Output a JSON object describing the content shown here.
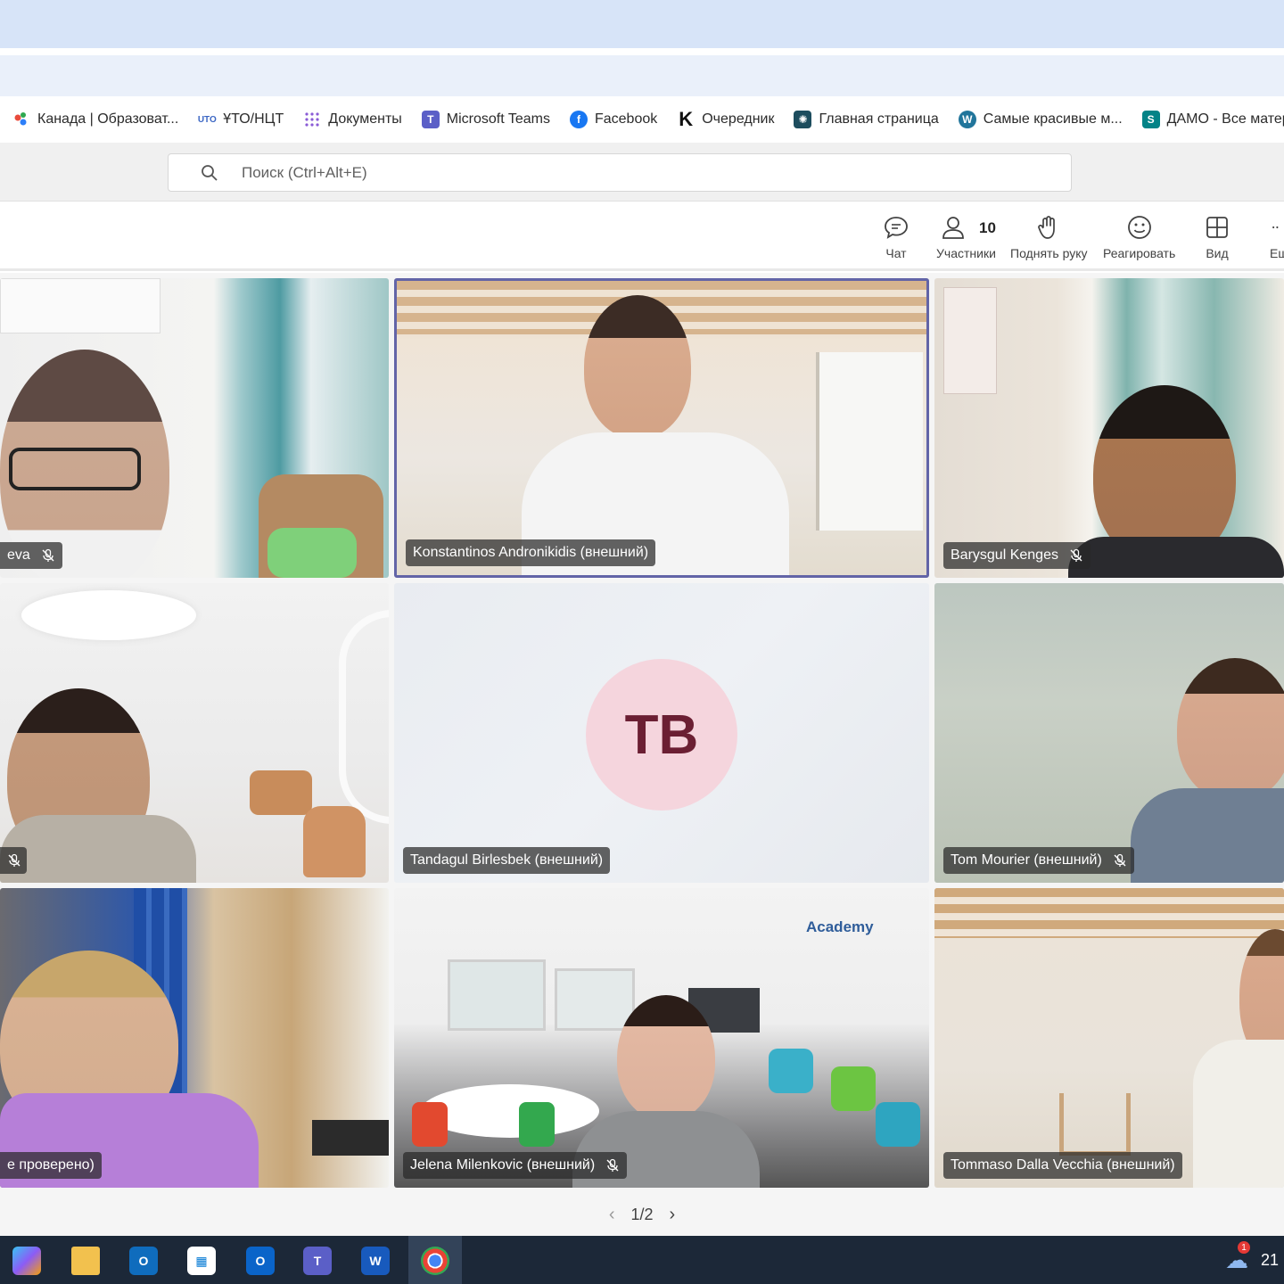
{
  "bookmarks": [
    {
      "label": "Канада | Образоват...",
      "icon": "colorful-dots-icon",
      "color": "#e94b3c"
    },
    {
      "label": "ҰТО/НЦТ",
      "icon": "uto-logo-icon",
      "color": "#3b66c4"
    },
    {
      "label": "Документы",
      "icon": "grid-dots-icon",
      "color": "#8a5bd6"
    },
    {
      "label": "Microsoft Teams",
      "icon": "teams-icon",
      "color": "#5b5fc7"
    },
    {
      "label": "Facebook",
      "icon": "facebook-icon",
      "color": "#1877f2"
    },
    {
      "label": "Очередник",
      "icon": "k-logo-icon",
      "color": "#111111"
    },
    {
      "label": "Главная страница",
      "icon": "react-logo-icon",
      "color": "#1d4d5e"
    },
    {
      "label": "Самые красивые м...",
      "icon": "wordpress-icon",
      "color": "#21759b"
    },
    {
      "label": "ДАМО - Все матер...",
      "icon": "sharepoint-icon",
      "color": "#038387"
    }
  ],
  "search": {
    "placeholder": "Поиск (Ctrl+Alt+E)"
  },
  "toolbar": {
    "chat": "Чат",
    "participants": "Участники",
    "participants_count": "10",
    "raise_hand": "Поднять руку",
    "react": "Реагировать",
    "view": "Вид",
    "more": "Ещ"
  },
  "tiles": [
    {
      "name": "eva",
      "muted": true
    },
    {
      "name": "Konstantinos Andronikidis (внешний)",
      "muted": false,
      "active": true
    },
    {
      "name": "Barysgul Kenges",
      "muted": true
    },
    {
      "name": "",
      "muted": true
    },
    {
      "name": "Tandagul Birlesbek (внешний)",
      "muted": false,
      "initials": "TB"
    },
    {
      "name": "Tom Mourier (внешний)",
      "muted": true
    },
    {
      "name": "е проверено)",
      "muted": false
    },
    {
      "name": "Jelena Milenkovic (внешний)",
      "muted": true,
      "background_text": "Academy"
    },
    {
      "name": "Tommaso Dalla Vecchia (внешний)",
      "muted": false
    }
  ],
  "pager": {
    "text": "1/2"
  },
  "taskbar": {
    "clock": "21",
    "notification_count": "1"
  }
}
